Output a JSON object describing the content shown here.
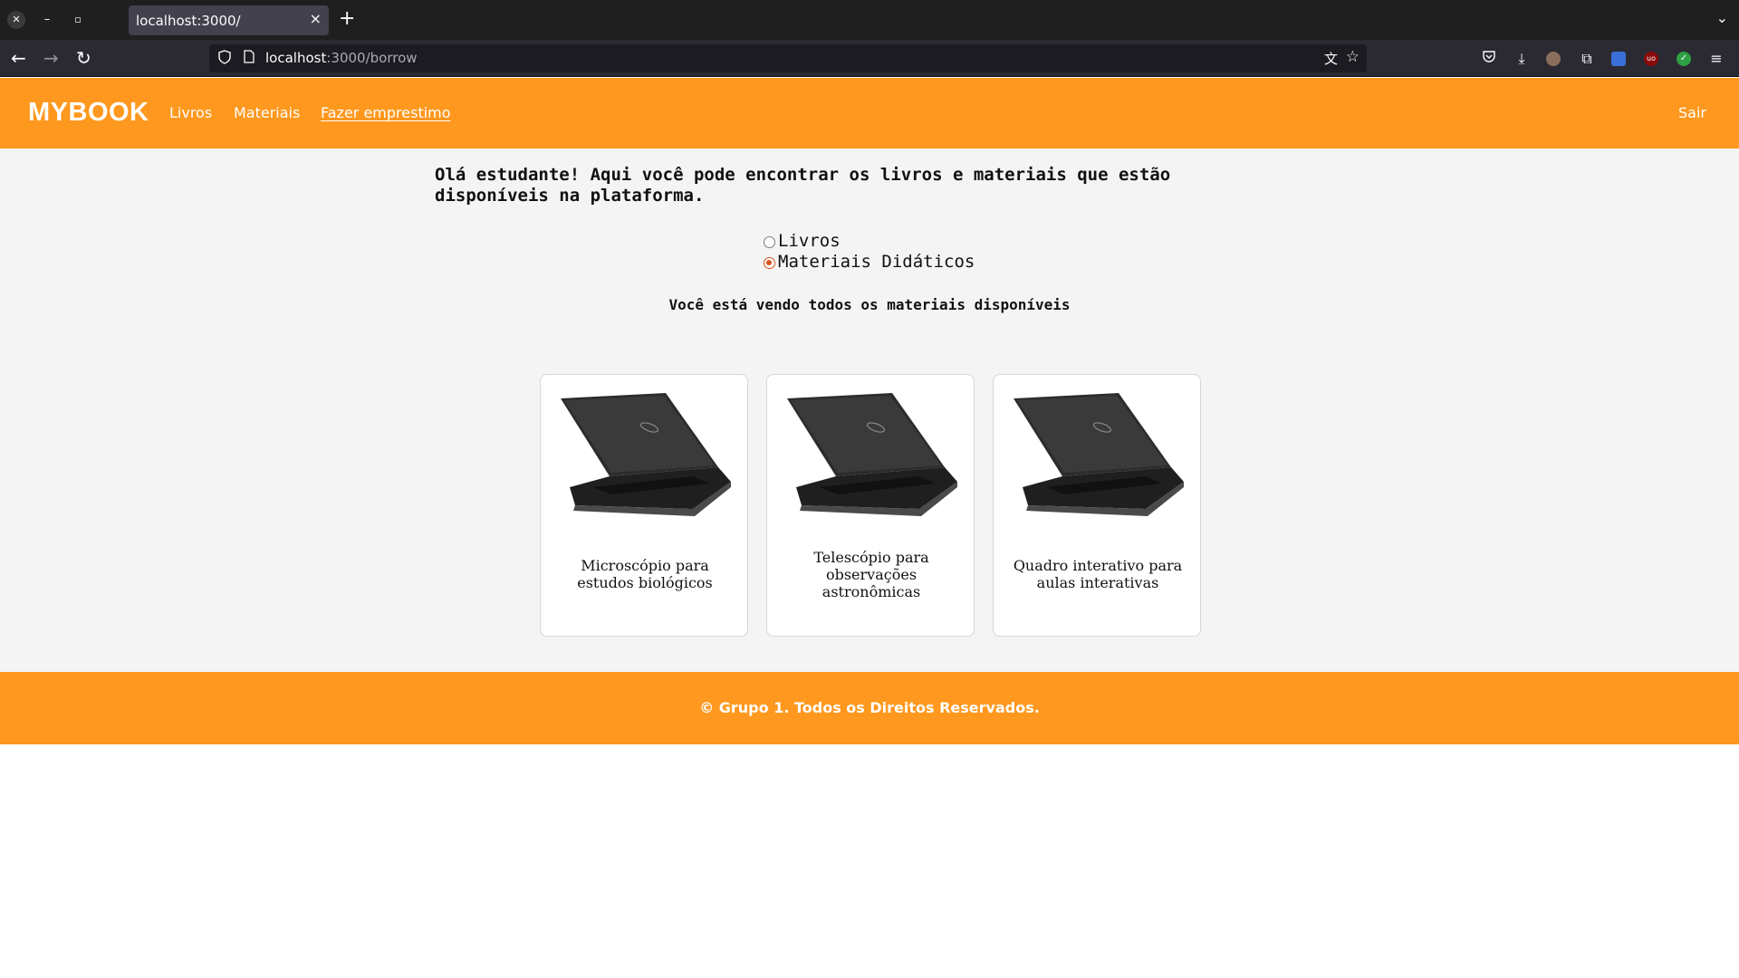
{
  "browser": {
    "tab_title": "localhost:3000/",
    "tab_close": "×",
    "new_tab": "+",
    "url_host": "localhost",
    "url_rest": ":3000/borrow",
    "icons": [
      "back-icon",
      "forward-icon",
      "reload-icon",
      "shield-icon",
      "page-icon",
      "translate-icon",
      "star-icon",
      "pocket-icon",
      "download-icon",
      "account-icon",
      "extensions-icon",
      "ublock-icon",
      "menu-icon"
    ]
  },
  "header": {
    "logo": "MYBOOK",
    "nav": [
      {
        "label": "Livros",
        "active": false
      },
      {
        "label": "Materiais",
        "active": false
      },
      {
        "label": "Fazer emprestimo",
        "active": true
      }
    ],
    "logout": "Sair",
    "color": "#ff981e"
  },
  "main": {
    "intro": "Olá estudante! Aqui você pode encontrar os livros e materiais que estão disponíveis na plataforma.",
    "filter": {
      "options": [
        {
          "label": "Livros",
          "checked": false
        },
        {
          "label": "Materiais Didáticos",
          "checked": true
        }
      ]
    },
    "subtitle": "Você está vendo todos os materiais disponíveis",
    "cards": [
      {
        "title": "Microscópio para estudos biológicos"
      },
      {
        "title": "Telescópio para observações astronômicas"
      },
      {
        "title": "Quadro interativo para aulas interativas"
      }
    ]
  },
  "footer": {
    "text": "© Grupo 1. Todos os Direitos Reservados."
  }
}
